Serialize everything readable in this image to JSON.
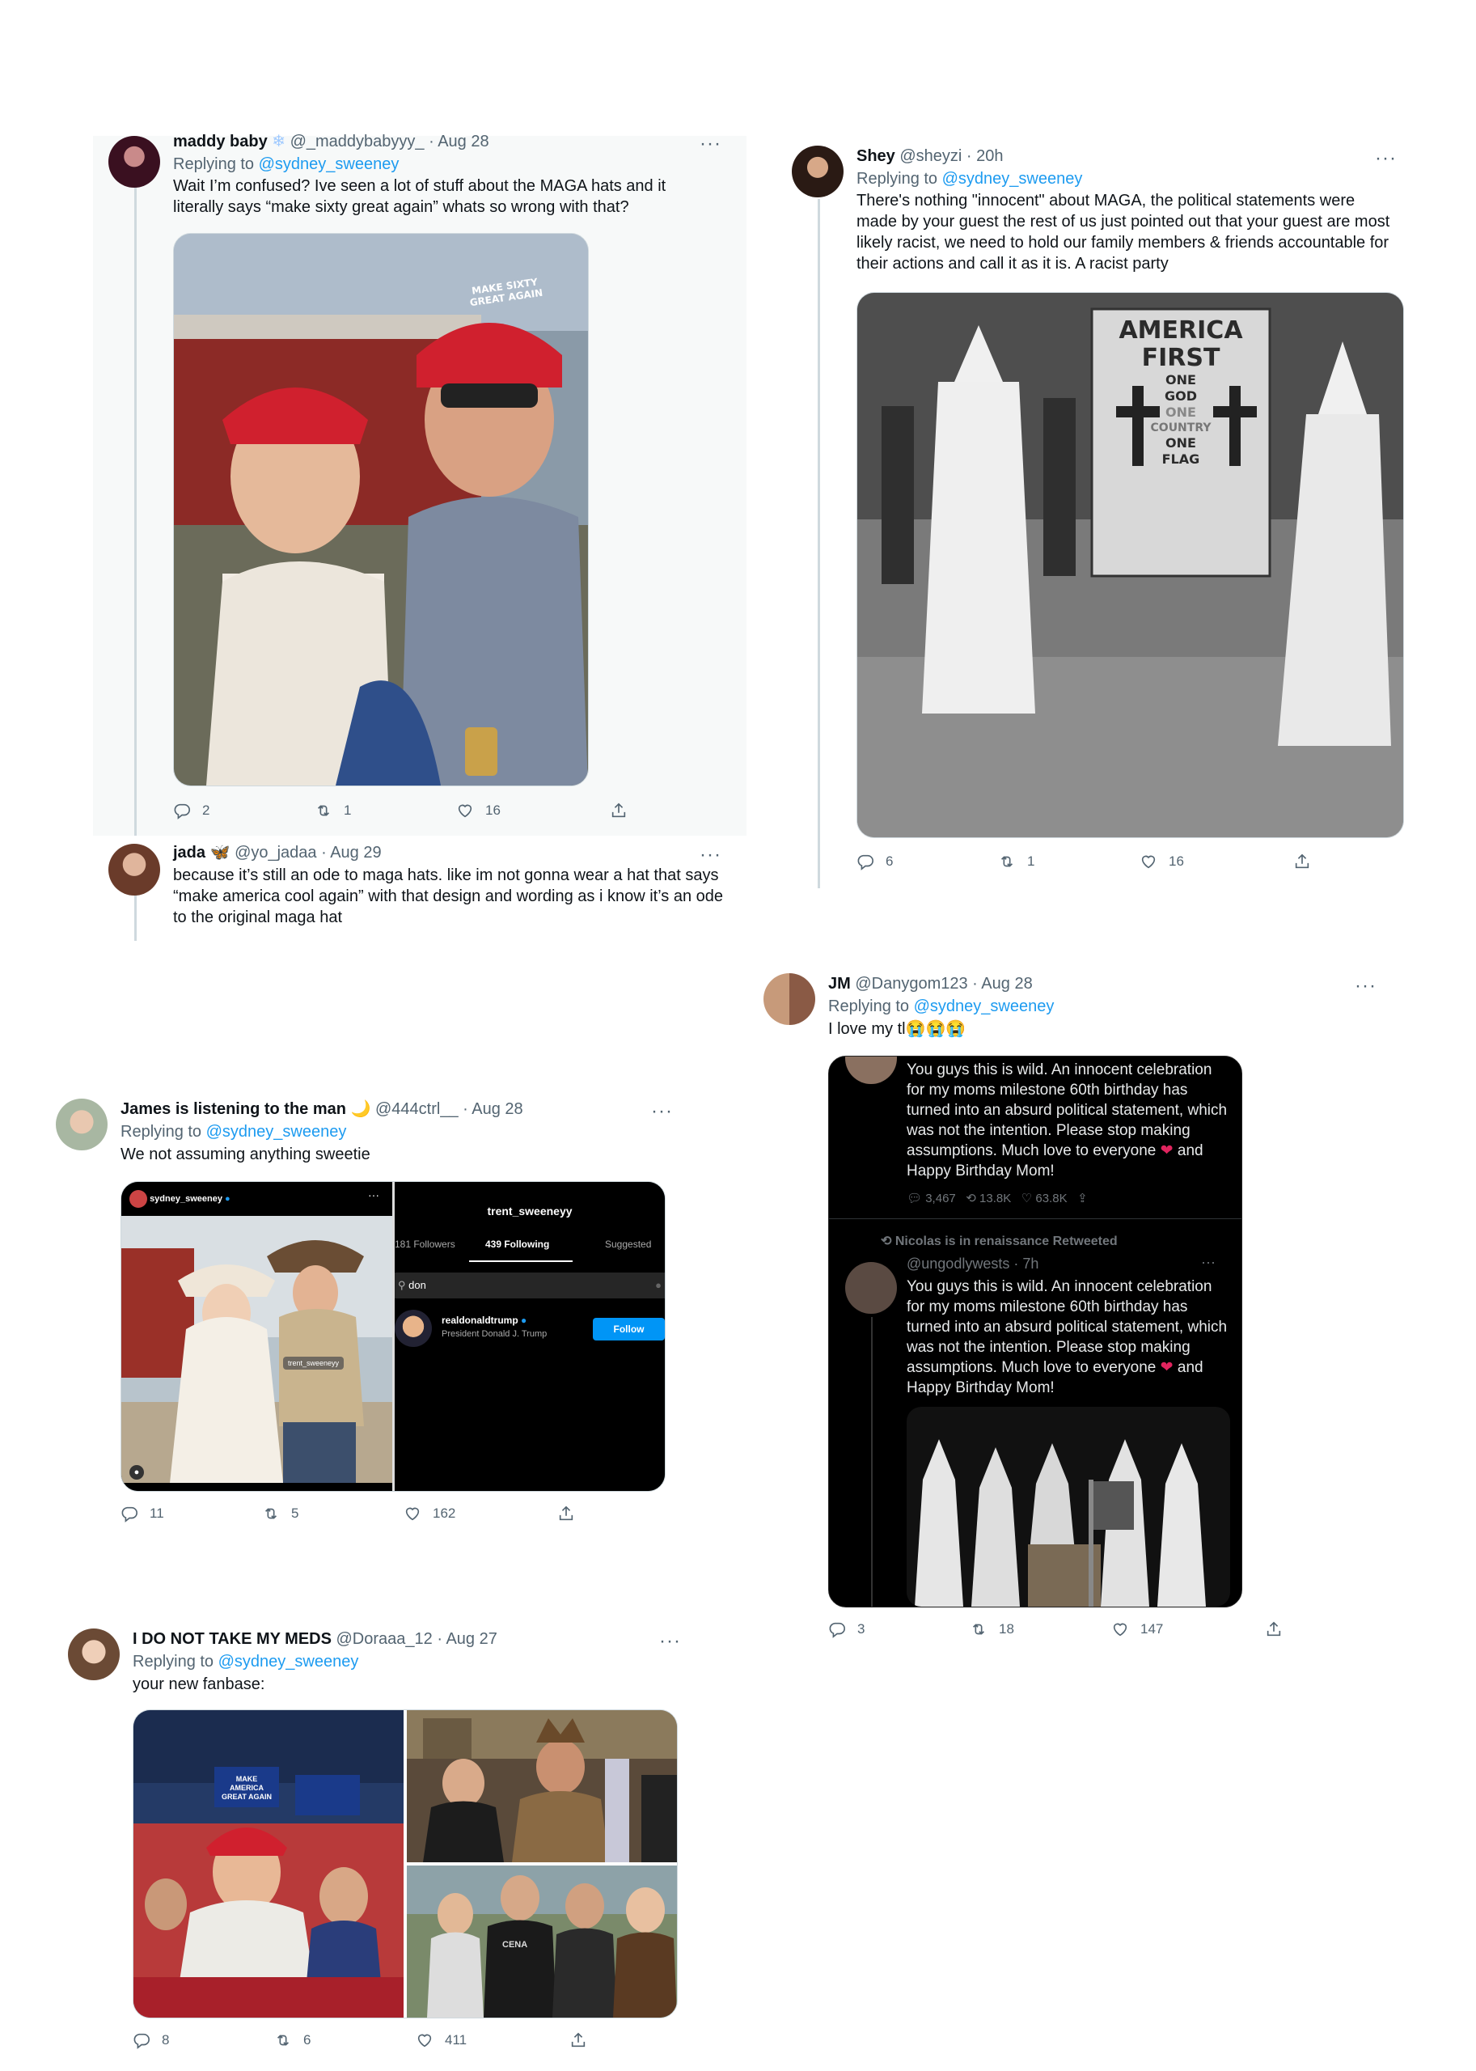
{
  "t1": {
    "name": "maddy baby",
    "handle": "@_maddybabyyy_ · Aug 28",
    "replying_prefix": "Replying to ",
    "replying_to": "@sydney_sweeney",
    "text": "Wait I’m confused? Ive seen a lot of stuff about the MAGA hats and it literally says “make sixty great again” whats so wrong with that?",
    "hat_text": "MAKE SIXTY GREAT AGAIN",
    "replies": "2",
    "retweets": "1",
    "likes": "16"
  },
  "t2": {
    "name": "jada",
    "handle": "@yo_jadaa · Aug 29",
    "text": "because it’s still an ode to maga hats. like im not gonna wear a hat that says “make america cool again” with that design and wording as i know it’s an ode to the original maga hat"
  },
  "t3": {
    "name": "Shey",
    "handle": "@sheyzi · 20h",
    "replying_prefix": "Replying to ",
    "replying_to": "@sydney_sweeney",
    "text": "There's nothing \"innocent\" about MAGA, the political statements were made by your guest the rest of us just pointed out that your guest are most likely racist, we need to hold our family members & friends accountable for their actions and call it as it is. A racist party",
    "banner_lines": [
      "AMERICA",
      "FIRST",
      "ONE",
      "GOD",
      "ONE",
      "COUNTRY",
      "ONE",
      "FLAG"
    ],
    "replies": "6",
    "retweets": "1",
    "likes": "16"
  },
  "t4": {
    "name": "JM",
    "handle": "@Danygom123 · Aug 28",
    "replying_prefix": "Replying to ",
    "replying_to": "@sydney_sweeney",
    "text": "I love my tl😭😭😭",
    "embed1_text_a": "You guys this is wild. An innocent celebration for my moms milestone 60th birthday has turned into an absurd political statement, which was not the intention. Please stop making assumptions. Much love to everyone",
    "embed1_text_b": "and Happy Birthday Mom!",
    "embed1_replies": "3,467",
    "embed1_retweets": "13.8K",
    "embed1_likes": "63.8K",
    "retweeted_label": "Nicolas is in renaissance Retweeted",
    "embed2_handle": "@ungodlywests · 7h",
    "embed2_text_a": "You guys this is wild. An innocent celebration for my moms milestone 60th birthday has turned into an absurd political statement, which was not the intention. Please stop making assumptions. Much love to everyone",
    "embed2_text_b": "and Happy Birthday Mom!",
    "replies": "3",
    "retweets": "18",
    "likes": "147"
  },
  "t5": {
    "name": "James is listening to the man",
    "moon": "🌙",
    "handle": "@444ctrl__ · Aug 28",
    "replying_prefix": "Replying to ",
    "replying_to": "@sydney_sweeney",
    "text": "We not assuming anything sweetie",
    "ig_user": "sydney_sweeney",
    "tag_label": "trent_sweeneyy",
    "profile_title": "trent_sweeneyy",
    "followers": "181 Followers",
    "following": "439 Following",
    "suggested": "Suggested",
    "search_value": "don",
    "result_user": "realdonaldtrump",
    "result_name": "President Donald J. Trump",
    "follow_label": "Follow",
    "replies": "11",
    "retweets": "5",
    "likes": "162"
  },
  "t6": {
    "name": "I DO NOT TAKE MY MEDS",
    "handle": "@Doraaa_12 · Aug 27",
    "replying_prefix": "Replying to ",
    "replying_to": "@sydney_sweeney",
    "text": "your new fanbase:",
    "sign_text": "MAKE AMERICA GREAT AGAIN",
    "shirt_text": "CENA",
    "replies": "8",
    "retweets": "6",
    "likes": "411"
  },
  "colors": {
    "link": "#1d9bf0",
    "secondary": "#536471",
    "line": "#cfd9de",
    "heart": "#e0245e"
  }
}
